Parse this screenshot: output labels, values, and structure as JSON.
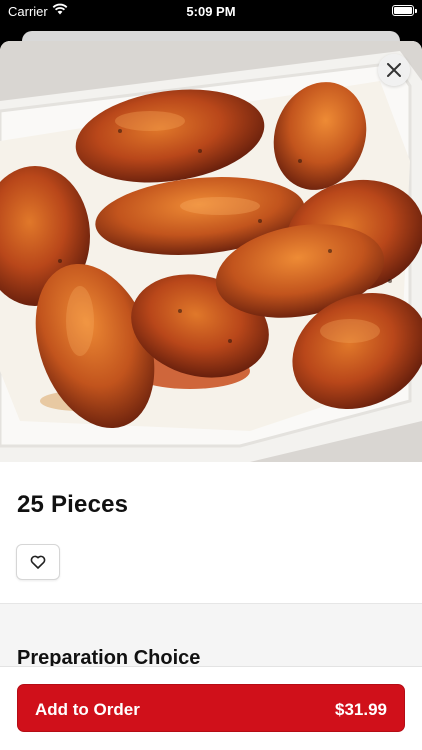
{
  "status_bar": {
    "carrier": "Carrier",
    "time": "5:09 PM"
  },
  "item": {
    "image_icon": "food-photo-chicken-wings",
    "name": "25 Pieces"
  },
  "icons": {
    "close": "close-icon",
    "favorite": "heart-outline-icon"
  },
  "sections": {
    "preparation_title": "Preparation Choice"
  },
  "footer": {
    "add_label": "Add to Order",
    "price": "$31.99"
  },
  "colors": {
    "accent": "#d0101a",
    "sheet": "#ffffff",
    "section_bg": "#f5f5f5"
  }
}
